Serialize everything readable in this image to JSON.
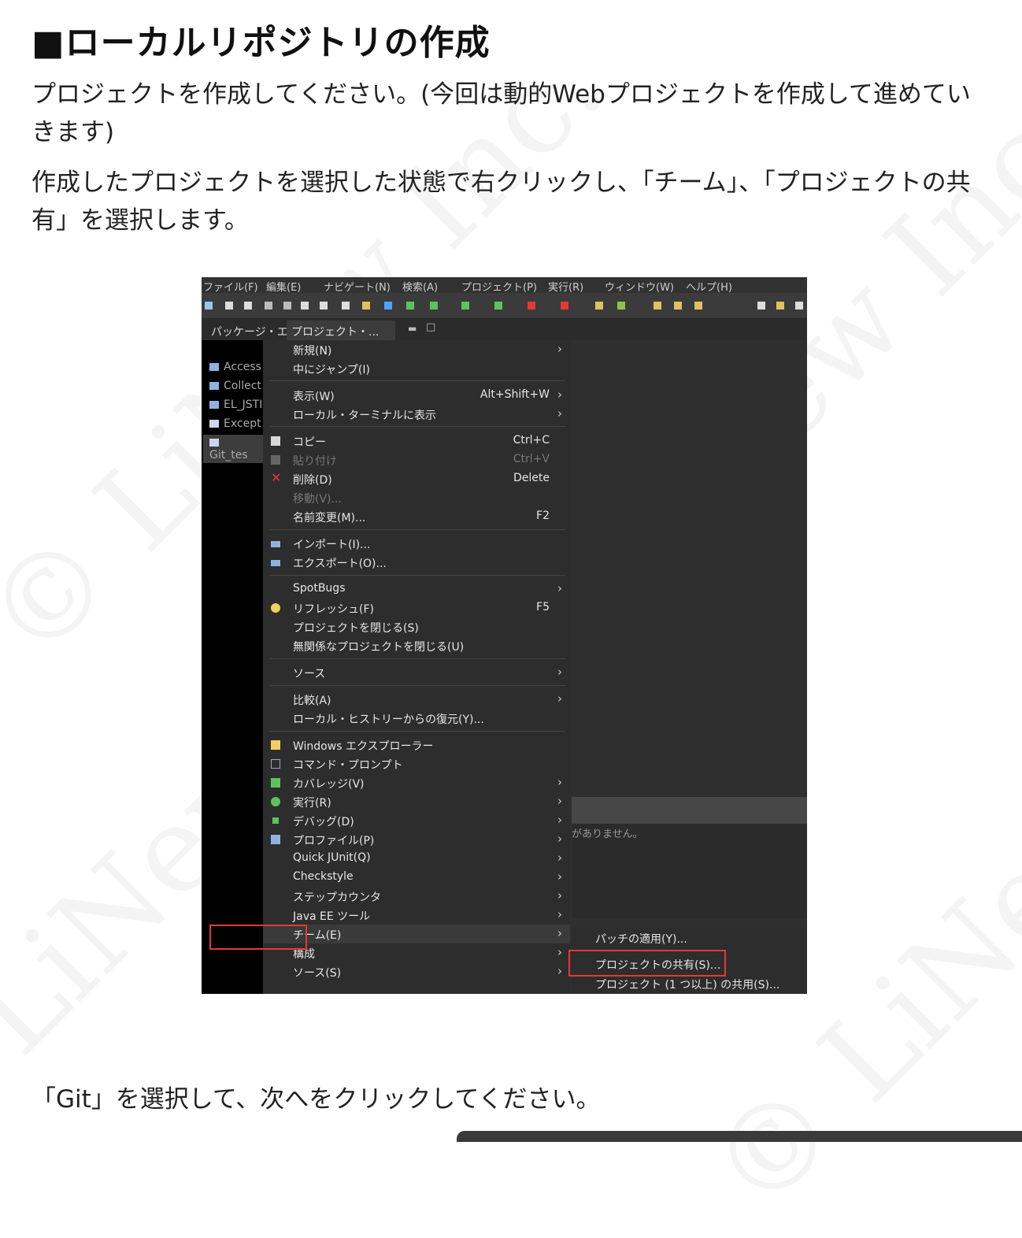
{
  "heading": "■ローカルリポジトリの作成",
  "paragraphs": [
    "プロジェクトを作成してください。(今回は動的Webプロジェクトを作成して進めていきます)",
    "作成したプロジェクトを選択した状態で右クリックし、「チーム」、「プロジェクトの共有」を選択します。",
    "「Git」を選択して、次へをクリックしてください。"
  ],
  "watermark": "© LiNew Inc.",
  "screenshot": {
    "menubar": [
      "ファイル(F)",
      "編集(E)",
      "ナビゲート(N)",
      "検索(A)",
      "プロジェクト(P)",
      "実行(R)",
      "ウィンドウ(W)",
      "ヘルプ(H)"
    ],
    "tabs": [
      "パッケージ・エ...",
      "プロジェクト・..."
    ],
    "tree": [
      "Access",
      "Collect",
      "EL_JSTI",
      "Except",
      "Git_tes"
    ],
    "right_message": "がありません。",
    "context_menu": [
      {
        "label": "新規(N)",
        "shortcut": "",
        "arrow": true
      },
      {
        "label": "中にジャンプ(I)",
        "shortcut": "",
        "arrow": false
      },
      {
        "label": "表示(W)",
        "shortcut": "Alt+Shift+W",
        "arrow": true
      },
      {
        "label": "ローカル・ターミナルに表示",
        "shortcut": "",
        "arrow": true
      },
      {
        "label": "コピー",
        "shortcut": "Ctrl+C",
        "arrow": false
      },
      {
        "label": "貼り付け",
        "shortcut": "Ctrl+V",
        "arrow": false,
        "disabled": true
      },
      {
        "label": "削除(D)",
        "shortcut": "Delete",
        "arrow": false
      },
      {
        "label": "移動(V)...",
        "shortcut": "",
        "arrow": false,
        "disabled": true
      },
      {
        "label": "名前変更(M)...",
        "shortcut": "F2",
        "arrow": false
      },
      {
        "label": "インポート(I)...",
        "shortcut": "",
        "arrow": false
      },
      {
        "label": "エクスポート(O)...",
        "shortcut": "",
        "arrow": false
      },
      {
        "label": "SpotBugs",
        "shortcut": "",
        "arrow": true
      },
      {
        "label": "リフレッシュ(F)",
        "shortcut": "F5",
        "arrow": false
      },
      {
        "label": "プロジェクトを閉じる(S)",
        "shortcut": "",
        "arrow": false
      },
      {
        "label": "無関係なプロジェクトを閉じる(U)",
        "shortcut": "",
        "arrow": false
      },
      {
        "label": "ソース",
        "shortcut": "",
        "arrow": true
      },
      {
        "label": "比較(A)",
        "shortcut": "",
        "arrow": true
      },
      {
        "label": "ローカル・ヒストリーからの復元(Y)...",
        "shortcut": "",
        "arrow": false
      },
      {
        "label": "Windows エクスプローラー",
        "shortcut": "",
        "arrow": false
      },
      {
        "label": "コマンド・プロンプト",
        "shortcut": "",
        "arrow": false
      },
      {
        "label": "カバレッジ(V)",
        "shortcut": "",
        "arrow": true
      },
      {
        "label": "実行(R)",
        "shortcut": "",
        "arrow": true
      },
      {
        "label": "デバッグ(D)",
        "shortcut": "",
        "arrow": true
      },
      {
        "label": "プロファイル(P)",
        "shortcut": "",
        "arrow": true
      },
      {
        "label": "Quick JUnit(Q)",
        "shortcut": "",
        "arrow": true
      },
      {
        "label": "Checkstyle",
        "shortcut": "",
        "arrow": true
      },
      {
        "label": "ステップカウンタ",
        "shortcut": "",
        "arrow": true
      },
      {
        "label": "Java EE ツール",
        "shortcut": "",
        "arrow": true
      },
      {
        "label": "チーム(E)",
        "shortcut": "",
        "arrow": true
      },
      {
        "label": "構成",
        "shortcut": "",
        "arrow": true
      },
      {
        "label": "ソース(S)",
        "shortcut": "",
        "arrow": true
      }
    ],
    "arrow_glyph": "›",
    "submenu": [
      "パッチの適用(Y)...",
      "プロジェクトの共有(S)...",
      "プロジェクト (1 つ以上) の共用(S)..."
    ]
  }
}
